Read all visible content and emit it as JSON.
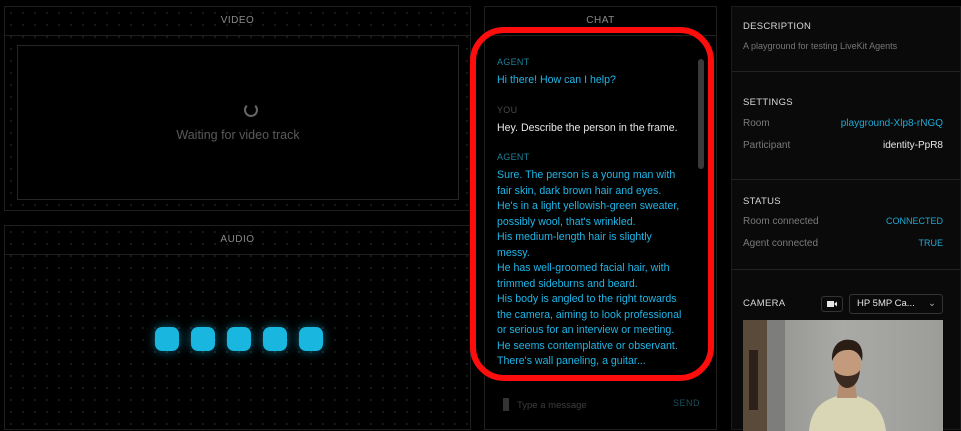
{
  "video": {
    "title": "VIDEO",
    "waiting": "Waiting for video track"
  },
  "audio": {
    "title": "AUDIO",
    "bars": [
      1,
      1,
      1,
      1,
      1
    ],
    "accent": "#19b6e0"
  },
  "chat": {
    "title": "CHAT",
    "messages": [
      {
        "sender": "AGENT",
        "text": "Hi there! How can I help?"
      },
      {
        "sender": "YOU",
        "text": "Hey. Describe the person in the frame."
      },
      {
        "sender": "AGENT",
        "lines": [
          "Sure. The person is a young man with",
          "fair skin, dark brown hair and eyes.",
          "He's in a light yellowish-green sweater,",
          "possibly wool, that's wrinkled.",
          "His medium-length hair is slightly",
          "messy.",
          "He has well-groomed facial hair, with",
          "trimmed sideburns and beard.",
          "His body is angled to the right towards",
          "the camera, aiming to look professional",
          "or serious for an interview or meeting.",
          "He seems contemplative or observant.",
          "There's wall paneling, a guitar..."
        ]
      }
    ],
    "input_placeholder": "Type a message",
    "send_label": "SEND"
  },
  "sidebar": {
    "description": {
      "title": "DESCRIPTION",
      "text": "A playground for testing LiveKit Agents"
    },
    "settings": {
      "title": "SETTINGS",
      "room_label": "Room",
      "room_value": "playground-Xlp8-rNGQ",
      "participant_label": "Participant",
      "participant_value": "identity-PpR8"
    },
    "status": {
      "title": "STATUS",
      "room_label": "Room connected",
      "room_value": "CONNECTED",
      "agent_label": "Agent connected",
      "agent_value": "TRUE"
    },
    "camera": {
      "title": "CAMERA",
      "device": "HP 5MP Ca...",
      "device_icon": "video-camera-icon"
    }
  },
  "colors": {
    "agent": "#1fb6e8",
    "you": "#e6e6e6",
    "status_value": "#1fa9d6",
    "highlight": "#ff0d0d"
  }
}
